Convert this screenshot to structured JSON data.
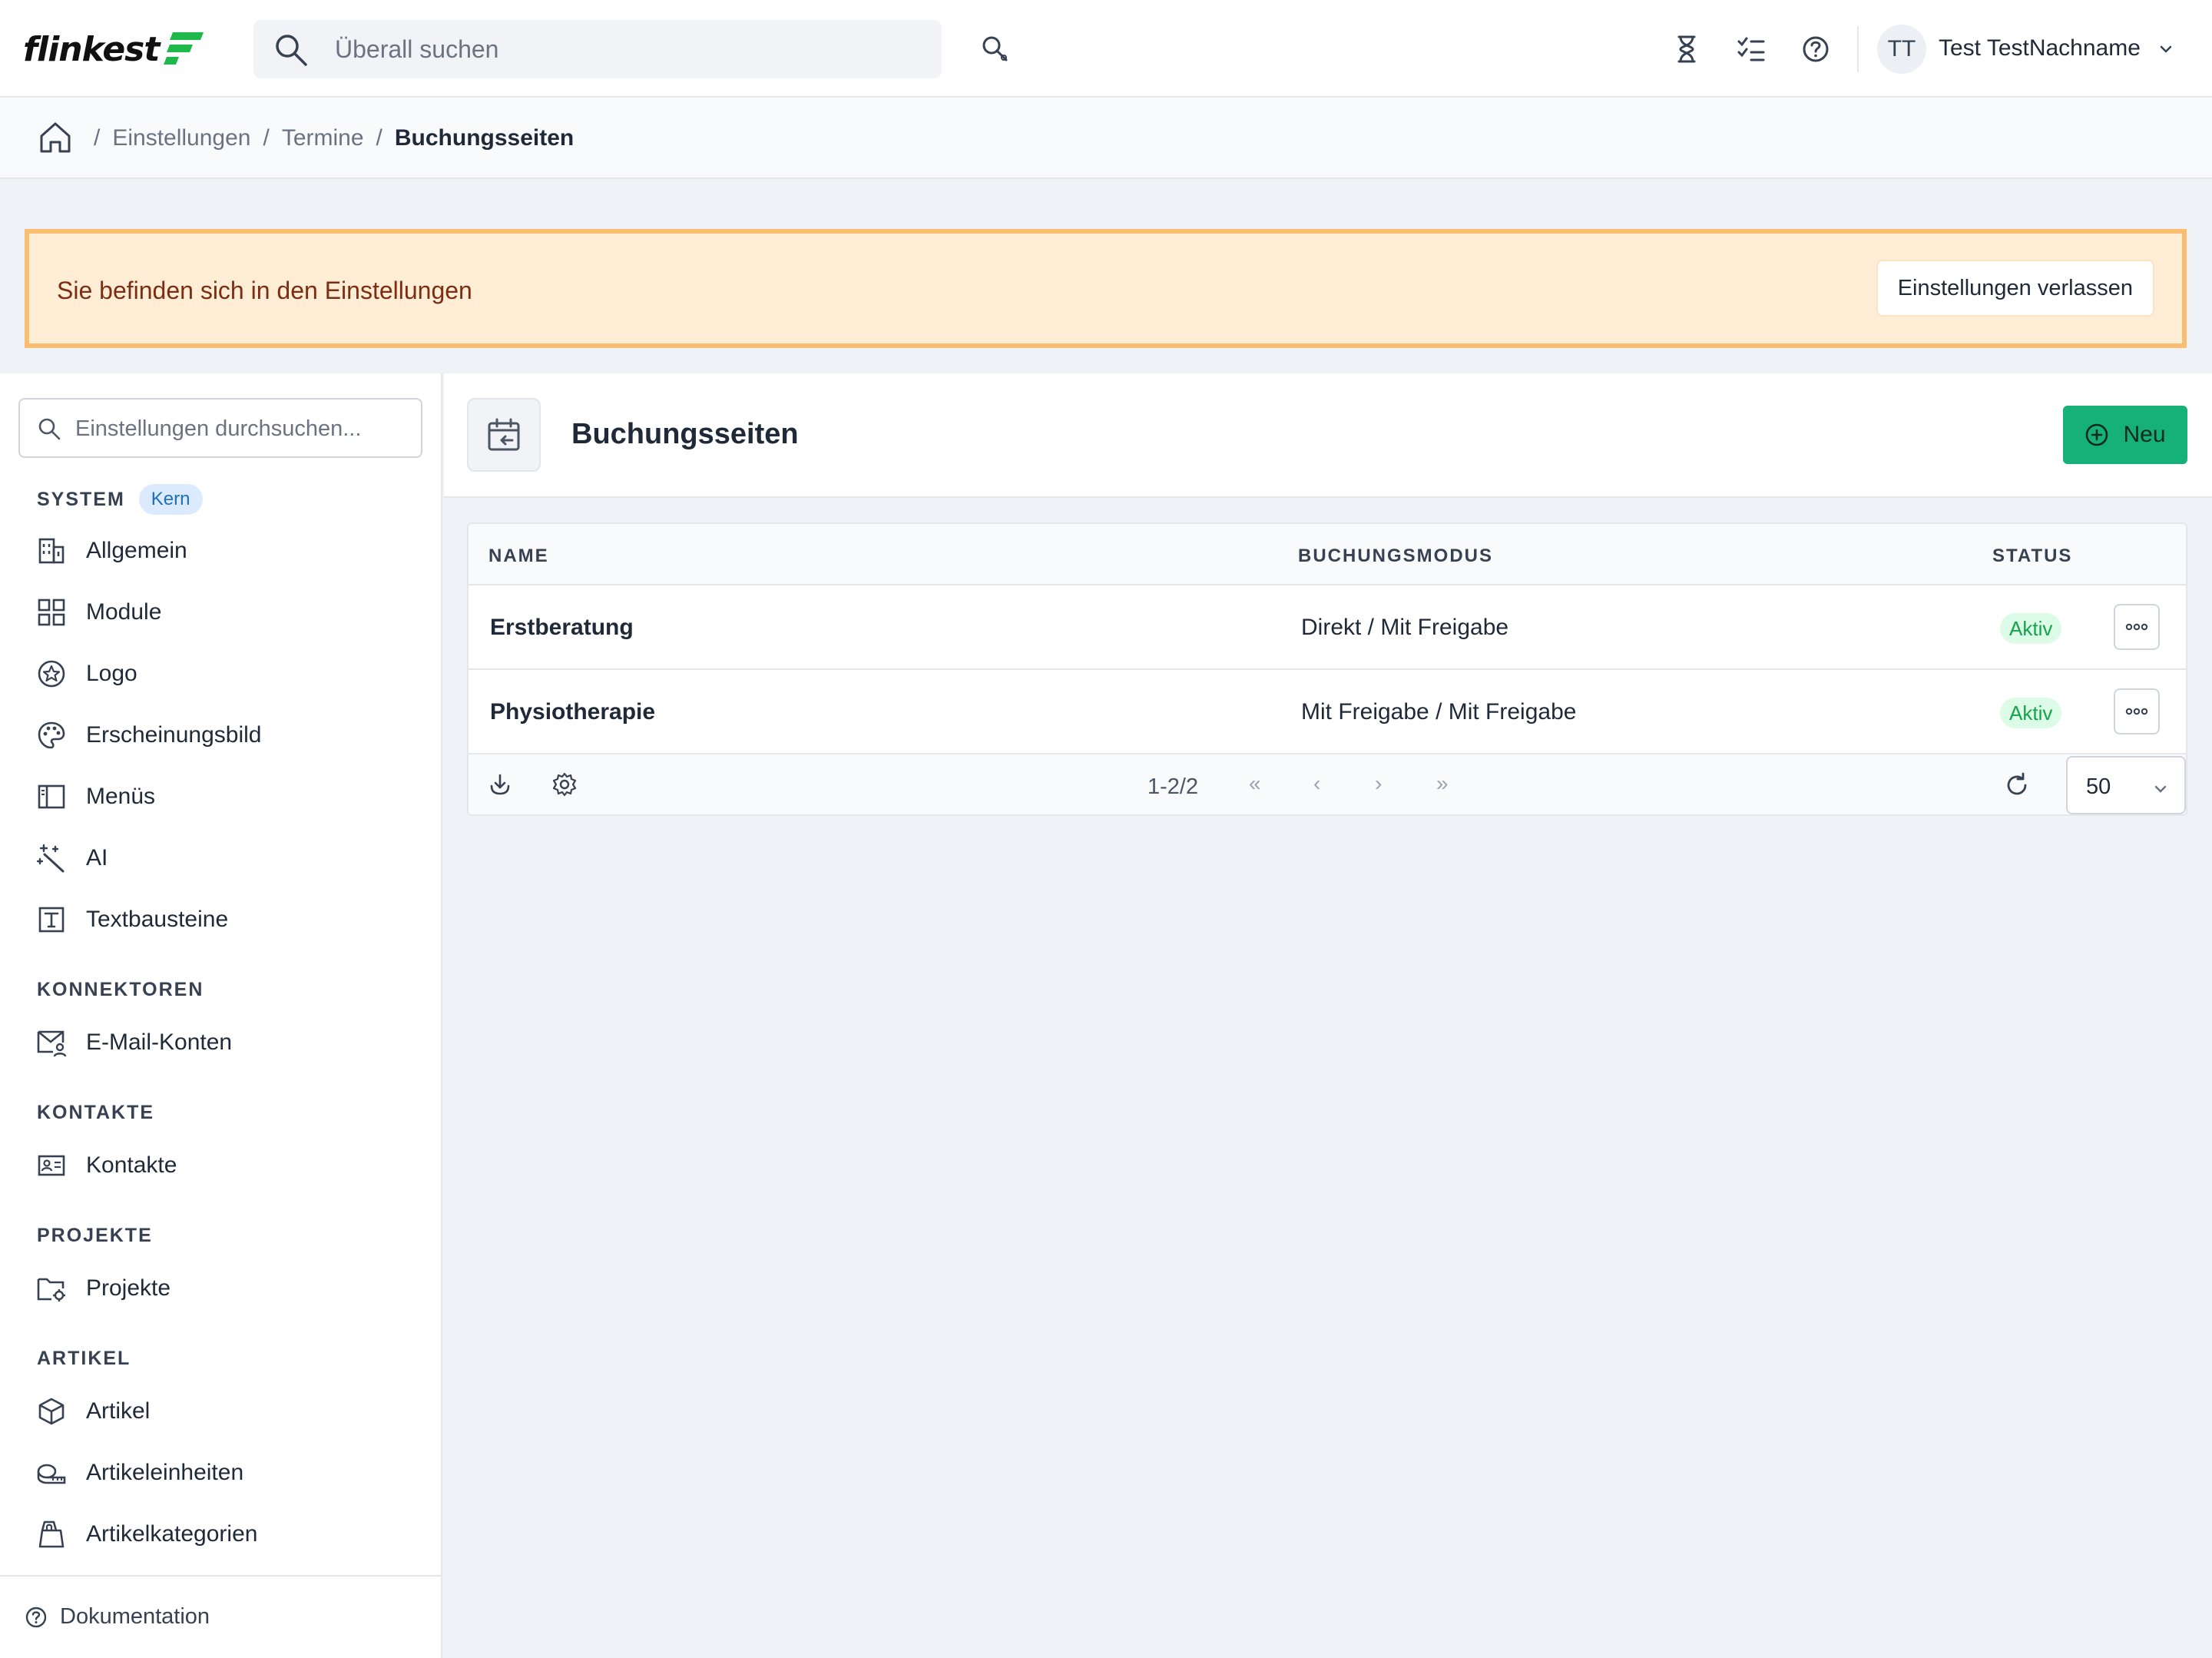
{
  "header": {
    "logo_text": "flinkest",
    "search_placeholder": "Überall suchen",
    "user_initials": "TT",
    "user_name": "Test TestNachname"
  },
  "breadcrumb": {
    "items": [
      "Einstellungen",
      "Termine",
      "Buchungsseiten"
    ],
    "separator": "/"
  },
  "banner": {
    "text": "Sie befinden sich in den Einstellungen",
    "button_label": "Einstellungen verlassen"
  },
  "sidebar": {
    "search_placeholder": "Einstellungen durchsuchen...",
    "sections": [
      {
        "title": "SYSTEM",
        "badge": "Kern",
        "items": [
          "Allgemein",
          "Module",
          "Logo",
          "Erscheinungsbild",
          "Menüs",
          "AI",
          "Textbausteine"
        ]
      },
      {
        "title": "KONNEKTOREN",
        "items": [
          "E-Mail-Konten"
        ]
      },
      {
        "title": "KONTAKTE",
        "items": [
          "Kontakte"
        ]
      },
      {
        "title": "PROJEKTE",
        "items": [
          "Projekte"
        ]
      },
      {
        "title": "ARTIKEL",
        "items": [
          "Artikel",
          "Artikeleinheiten",
          "Artikelkategorien"
        ]
      }
    ],
    "footer_label": "Dokumentation"
  },
  "page": {
    "title": "Buchungsseiten",
    "new_button": "Neu"
  },
  "table": {
    "columns": [
      "NAME",
      "BUCHUNGSMODUS",
      "STATUS"
    ],
    "rows": [
      {
        "name": "Erstberatung",
        "mode": "Direkt / Mit Freigabe",
        "status": "Aktiv"
      },
      {
        "name": "Physiotherapie",
        "mode": "Mit Freigabe / Mit Freigabe",
        "status": "Aktiv"
      }
    ],
    "pagination": {
      "range": "1-2/2",
      "first": "«",
      "prev": "‹",
      "next": "›",
      "last": "»",
      "page_size": "50"
    }
  },
  "colors": {
    "accent_green": "#16b07a",
    "banner_bg": "#ffedd5",
    "banner_border": "#fbbd6f",
    "status_green": "#16a34a"
  }
}
